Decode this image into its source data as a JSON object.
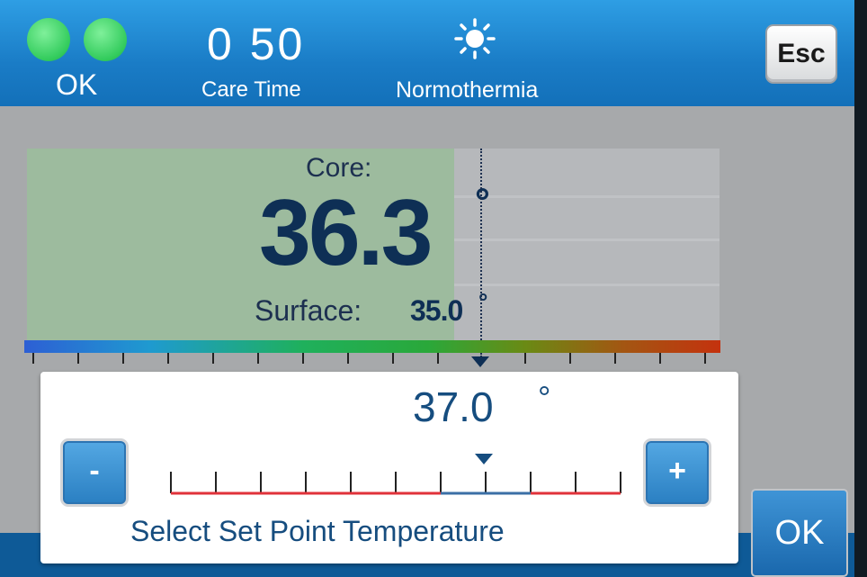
{
  "header": {
    "status_label": "OK",
    "care_time_value": "0 50",
    "care_time_label": "Care Time",
    "mode_icon": "sun-icon",
    "mode_label": "Normothermia",
    "esc_label": "Esc",
    "status_color": "#32cb5c"
  },
  "main": {
    "core_label": "Core:",
    "core_value": "36.3",
    "core_degree": "°",
    "surface_label": "Surface:",
    "surface_value": "35.0",
    "surface_degree": "°"
  },
  "setpoint": {
    "value": "37.0",
    "degree": "°",
    "minus_label": "-",
    "plus_label": "+",
    "instruction": "Select Set Point Temperature"
  },
  "ok_label": "OK",
  "colors": {
    "accent": "#1a7cc6",
    "text_dark": "#164d7f",
    "scale_red": "#e0323a",
    "scale_blue": "#3b6fa6"
  }
}
